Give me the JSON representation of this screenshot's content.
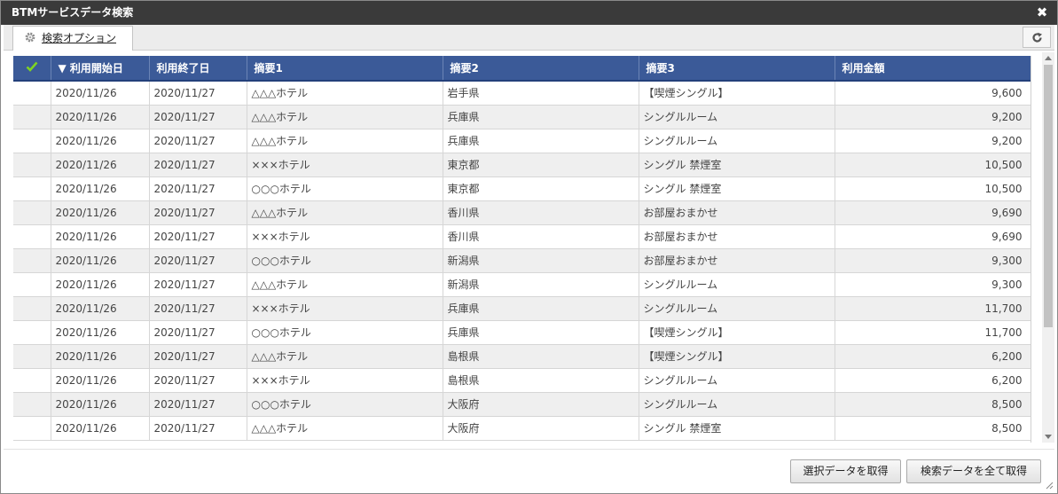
{
  "window": {
    "title": "BTMサービスデータ検索",
    "close_glyph": "✖"
  },
  "toolbar": {
    "tab_label": "検索オプション"
  },
  "grid": {
    "columns": [
      "",
      "▼ 利用開始日",
      "利用終了日",
      "摘要1",
      "摘要2",
      "摘要3",
      "利用金額"
    ],
    "rows": [
      [
        "2020/11/26",
        "2020/11/27",
        "△△△ホテル",
        "岩手県",
        "【喫煙シングル】",
        "9,600"
      ],
      [
        "2020/11/26",
        "2020/11/27",
        "△△△ホテル",
        "兵庫県",
        "シングルルーム",
        "9,200"
      ],
      [
        "2020/11/26",
        "2020/11/27",
        "△△△ホテル",
        "兵庫県",
        "シングルルーム",
        "9,200"
      ],
      [
        "2020/11/26",
        "2020/11/27",
        "×××ホテル",
        "東京都",
        "シングル 禁煙室",
        "10,500"
      ],
      [
        "2020/11/26",
        "2020/11/27",
        "○○○ホテル",
        "東京都",
        "シングル 禁煙室",
        "10,500"
      ],
      [
        "2020/11/26",
        "2020/11/27",
        "△△△ホテル",
        "香川県",
        "お部屋おまかせ",
        "9,690"
      ],
      [
        "2020/11/26",
        "2020/11/27",
        "×××ホテル",
        "香川県",
        "お部屋おまかせ",
        "9,690"
      ],
      [
        "2020/11/26",
        "2020/11/27",
        "○○○ホテル",
        "新潟県",
        "お部屋おまかせ",
        "9,300"
      ],
      [
        "2020/11/26",
        "2020/11/27",
        "△△△ホテル",
        "新潟県",
        "シングルルーム",
        "9,300"
      ],
      [
        "2020/11/26",
        "2020/11/27",
        "×××ホテル",
        "兵庫県",
        "シングルルーム",
        "11,700"
      ],
      [
        "2020/11/26",
        "2020/11/27",
        "○○○ホテル",
        "兵庫県",
        "【喫煙シングル】",
        "11,700"
      ],
      [
        "2020/11/26",
        "2020/11/27",
        "△△△ホテル",
        "島根県",
        "【喫煙シングル】",
        "6,200"
      ],
      [
        "2020/11/26",
        "2020/11/27",
        "×××ホテル",
        "島根県",
        "シングルルーム",
        "6,200"
      ],
      [
        "2020/11/26",
        "2020/11/27",
        "○○○ホテル",
        "大阪府",
        "シングルルーム",
        "8,500"
      ],
      [
        "2020/11/26",
        "2020/11/27",
        "△△△ホテル",
        "大阪府",
        "シングル 禁煙室",
        "8,500"
      ]
    ]
  },
  "buttons": {
    "get_selected": "選択データを取得",
    "get_all": "検索データを全て取得"
  },
  "colors": {
    "header_bg": "#3b5a98",
    "check": "#7ed321",
    "titlebar": "#3a3a3a"
  }
}
